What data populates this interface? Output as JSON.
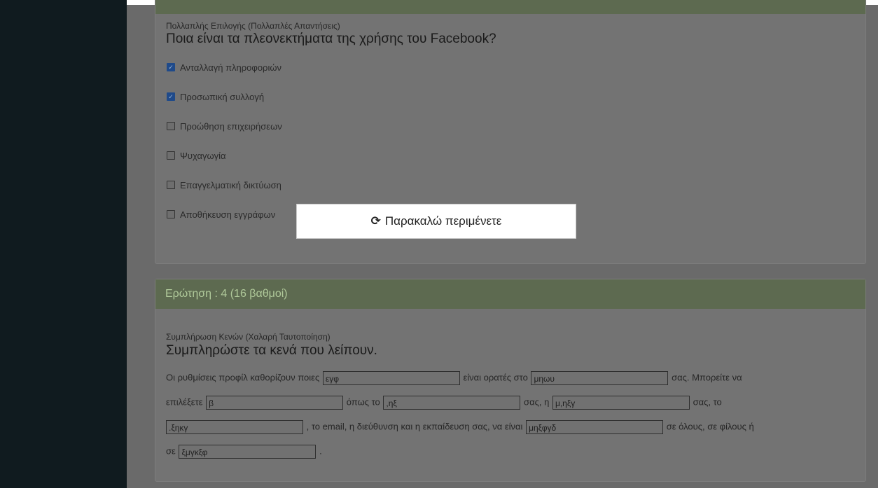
{
  "question3": {
    "type_label": "Πολλαπλής Επιλογής (Πολλαπλές Απαντήσεις)",
    "question_text": "Ποια είναι τα πλεονεκτήματα της χρήσης του Facebook?",
    "options": [
      {
        "label": "Ανταλλαγή πληροφοριών",
        "checked": true
      },
      {
        "label": "Προσωπική συλλογή",
        "checked": true
      },
      {
        "label": "Προώθηση επιχειρήσεων",
        "checked": false
      },
      {
        "label": "Ψυχαγωγία",
        "checked": false
      },
      {
        "label": "Επαγγελματική δικτύωση",
        "checked": false
      },
      {
        "label": "Αποθήκευση εγγράφων",
        "checked": false
      }
    ]
  },
  "question4": {
    "header": "Ερώτηση : 4 (16 βαθμοί)",
    "type_label": "Συμπλήρωση Κενών (Χαλαρή Ταυτοποίηση)",
    "question_text": "Συμπληρώστε τα κενά που λείπουν.",
    "text": {
      "t1": "Οι ρυθμίσεις προφίλ καθορίζουν ποιες",
      "t2": "είναι ορατές στο",
      "t3": "σας. Μπορείτε να",
      "t4": "επιλέξετε",
      "t5": "όπως το",
      "t6": "σας, η",
      "t7": "σας, το",
      "t8": ", το email, η διεύθυνση και η εκπαίδευση σας, να είναι",
      "t9": "σε όλους, σε φίλους ή",
      "t10": "σε",
      "t11": "."
    },
    "blanks": [
      "εγφ",
      "μηωυ",
      "β",
      ",ηξ",
      "μ,ηξγ",
      ".ξηκγ",
      "μηξφγδ",
      "ξμγκξφ"
    ]
  },
  "loading": {
    "icon": "refresh-icon",
    "message": "Παρακαλώ περιμένετε"
  }
}
